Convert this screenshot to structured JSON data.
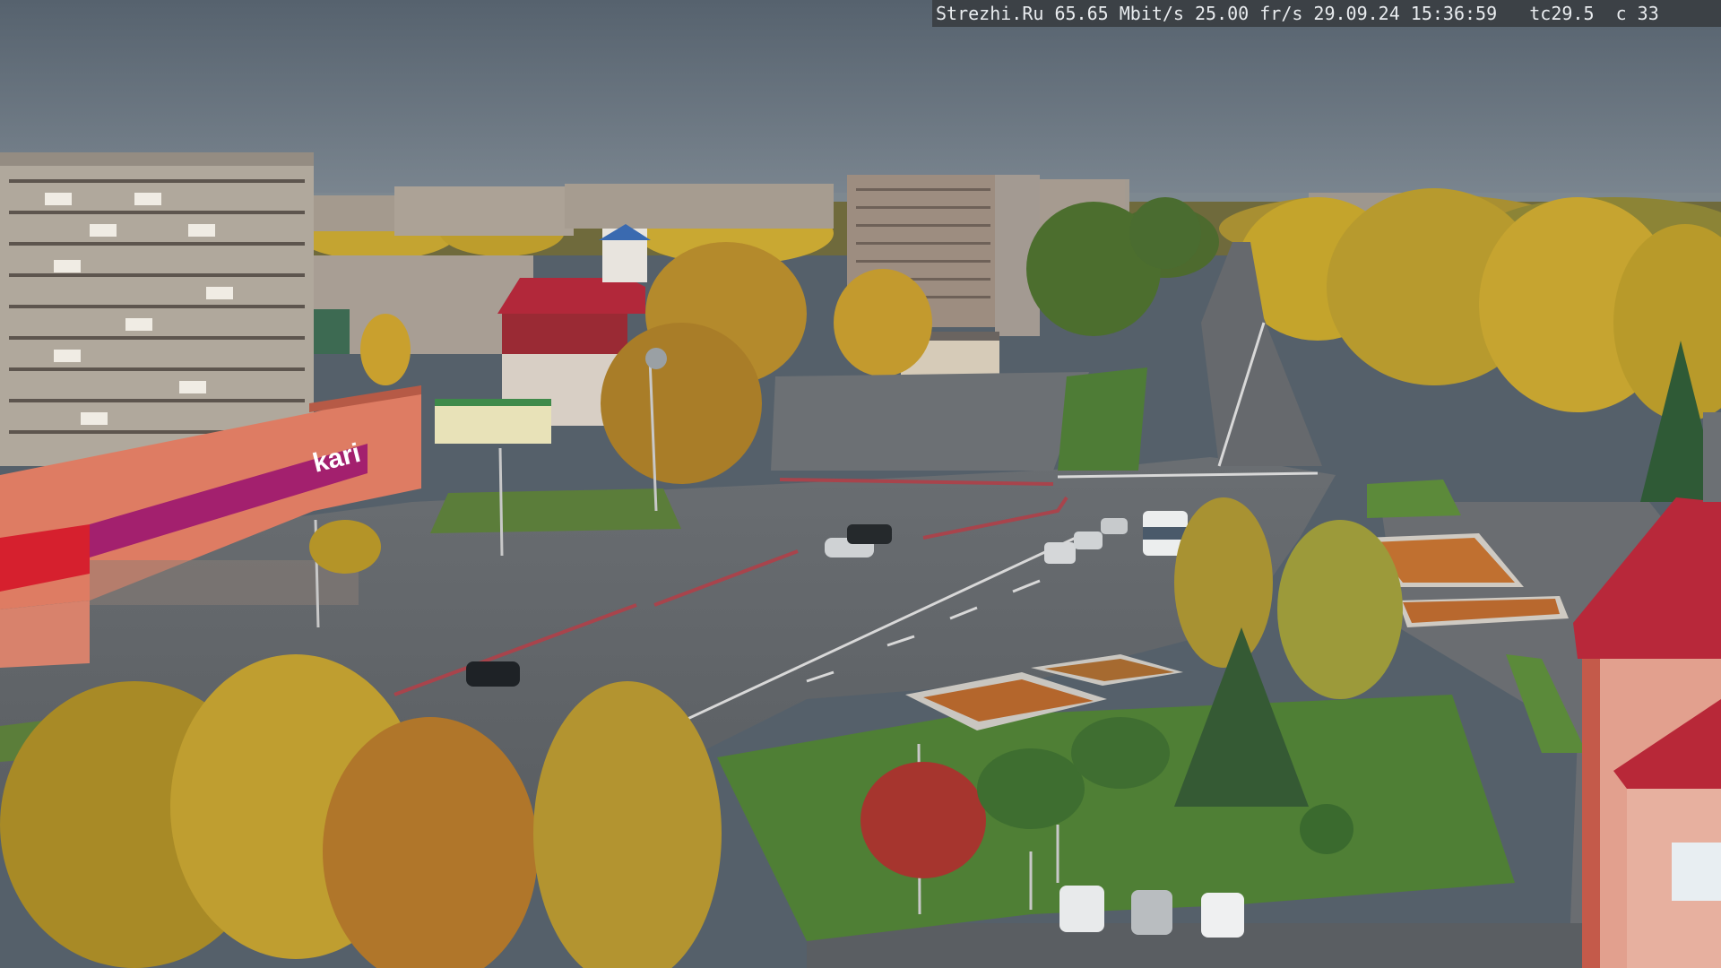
{
  "overlay": {
    "text": "Strezhi.Ru 65.65 Mbit/s 25.00 fr/s 29.09.24 15:36:59   tc29.5  c 33"
  },
  "storefront": {
    "brand": "kari"
  },
  "colors": {
    "sky": "#5c6874",
    "road": "#5d6165",
    "grass": "#4f7a34",
    "autumn_tree": "#c8a020",
    "facade_pink": "#e07a62",
    "kari_magenta": "#a3206e",
    "roof_red": "#b8283a"
  }
}
